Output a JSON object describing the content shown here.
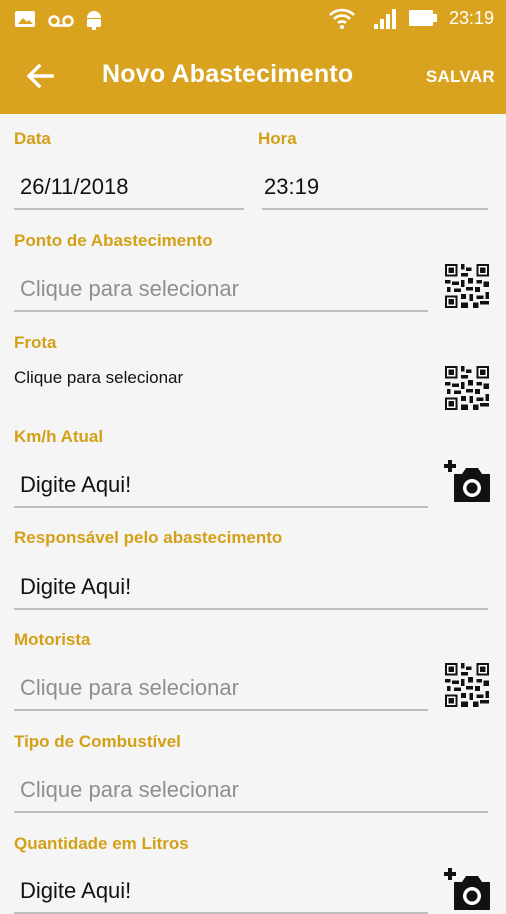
{
  "status_bar": {
    "time": "23:19",
    "icons": [
      "image-icon",
      "voicemail-icon",
      "android-icon",
      "wifi-icon",
      "signal-icon",
      "battery-icon"
    ]
  },
  "app_bar": {
    "title": "Novo Abastecimento",
    "save_label": "SALVAR",
    "back_icon": "arrow-back-icon",
    "background": "#d9a31f"
  },
  "form": {
    "data": {
      "label": "Data",
      "value": "26/11/2018"
    },
    "hora": {
      "label": "Hora",
      "value": "23:19"
    },
    "ponto": {
      "label": "Ponto de Abastecimento",
      "placeholder": "Clique para selecionar"
    },
    "frota": {
      "label": "Frota",
      "value": "Clique para selecionar"
    },
    "km": {
      "label": "Km/h Atual",
      "placeholder": "Digite Aqui!"
    },
    "responsavel": {
      "label": "Responsável pelo abastecimento",
      "placeholder": "Digite Aqui!"
    },
    "motorista": {
      "label": "Motorista",
      "placeholder": "Clique para selecionar"
    },
    "combustivel": {
      "label": "Tipo de Combustível",
      "placeholder": "Clique para selecionar"
    },
    "quantidade": {
      "label": "Quantidade em Litros",
      "placeholder": "Digite Aqui!"
    }
  },
  "colors": {
    "accent": "#d4a017",
    "divider": "#bdbdbd",
    "placeholder": "#8f8f8f"
  }
}
